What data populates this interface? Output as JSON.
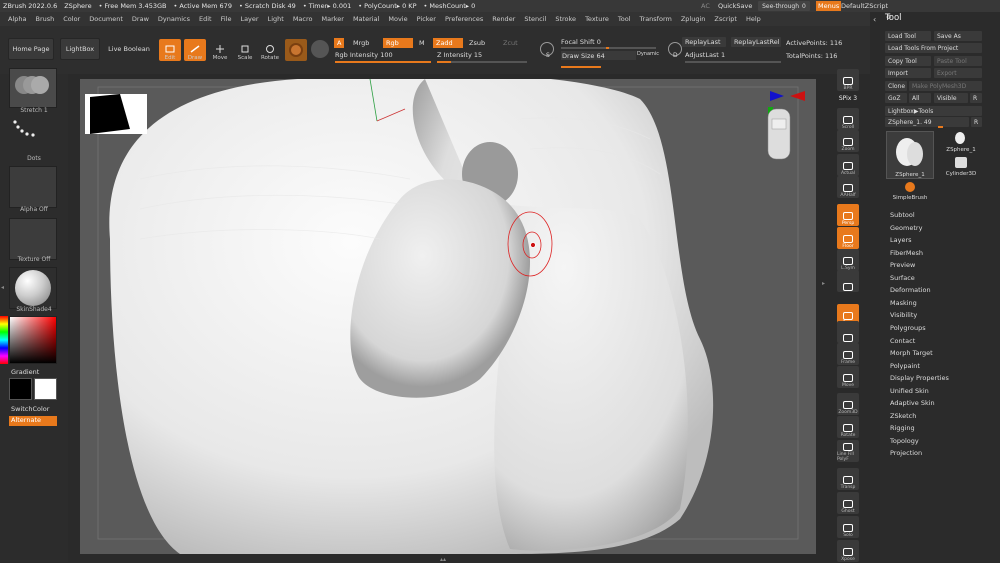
{
  "title_bar": {
    "app": "ZBrush 2022.0.6",
    "doc": "ZSphere",
    "free_mem": "• Free Mem 3.453GB",
    "active_mem": "• Active Mem 679",
    "scratch": "• Scratch Disk 49",
    "timer": "• Timer▸ 0.001",
    "polycount": "• PolyCount▸ 0 KP",
    "meshcount": "• MeshCount▸ 0",
    "ac": "AC",
    "quicksave": "QuickSave",
    "see_through": "See-through",
    "see_through_value": "0",
    "menus": "Menus",
    "default_zscript": "DefaultZScript"
  },
  "menu_bar": [
    "Alpha",
    "Brush",
    "Color",
    "Document",
    "Draw",
    "Dynamics",
    "Edit",
    "File",
    "Layer",
    "Light",
    "Macro",
    "Marker",
    "Material",
    "Movie",
    "Picker",
    "Preferences",
    "Render",
    "Stencil",
    "Stroke",
    "Texture",
    "Tool",
    "Transform",
    "Zplugin",
    "Zscript",
    "Help"
  ],
  "shelf": {
    "home_page": "Home Page",
    "lightbox": "LightBox",
    "live_boolean": "Live Boolean",
    "edit": "Edit",
    "draw": "Draw",
    "move": "Move",
    "scale": "Scale",
    "rotate": "Rotate",
    "a": "A",
    "mrgb": "Mrgb",
    "rgb": "Rgb",
    "m": "M",
    "zadd": "Zadd",
    "zsub": "Zsub",
    "zcut": "Zcut",
    "rgb_intensity": "Rgb Intensity",
    "rgb_intensity_value": "100",
    "z_intensity": "Z Intensity",
    "z_intensity_value": "15",
    "focal_shift": "Focal Shift",
    "focal_shift_value": "0",
    "draw_size": "Draw Size",
    "draw_size_value": "64",
    "dynamic": "Dynamic",
    "s": "S",
    "d": "D",
    "replay_last": "ReplayLast",
    "replay_last_rel": "ReplayLastRel",
    "adjust_last": "AdjustLast",
    "adjust_last_value": "1",
    "active_points": "ActivePoints: 116",
    "total_points": "TotalPoints: 116"
  },
  "left_panel": {
    "stroke": "Stretch 1",
    "alpha_dots": "Dots",
    "alpha": "Alpha Off",
    "texture": "Texture Off",
    "material": "SkinShade4",
    "gradient": "Gradient",
    "switch_color": "SwitchColor",
    "alternate": "Alternate"
  },
  "right_icons": [
    "BPR",
    "SPix 3",
    "Scroll",
    "Zoom",
    "Actual",
    "AAHalf",
    "Persp",
    "Floor",
    "L.Sym",
    "",
    "Qxyz",
    "",
    "Frame",
    "Move",
    "Zoom3D",
    "Rotate",
    "Line Fill PolyF",
    "Transp",
    "Ghost",
    "Solo",
    "Xpose"
  ],
  "tool_panel": {
    "title": "Tool",
    "load_tool": "Load Tool",
    "save_as": "Save As",
    "load_tools_from_project": "Load Tools From Project",
    "copy_tool": "Copy Tool",
    "paste_tool": "Paste Tool",
    "import": "Import",
    "export": "Export",
    "clone": "Clone",
    "make_polymesh": "Make PolyMesh3D",
    "goz": "GoZ",
    "all": "All",
    "visible": "Visible",
    "r": "R",
    "lightbox_tools": "Lightbox▶Tools",
    "zsphere_label": "ZSphere_1.",
    "zsphere_value": "49",
    "thumbs": [
      "ZSphere_1",
      "ZSphere_1",
      "Cylinder3D",
      "SimpleBrush"
    ],
    "sections": [
      "Subtool",
      "Geometry",
      "Layers",
      "FiberMesh",
      "Preview",
      "Surface",
      "Deformation",
      "Masking",
      "Visibility",
      "Polygroups",
      "Contact",
      "Morph Target",
      "Polypaint",
      "Display Properties",
      "Unified Skin",
      "Adaptive Skin",
      "ZSketch",
      "Rigging",
      "Topology",
      "Projection"
    ]
  },
  "colors": {
    "accent": "#e8791c",
    "panel": "#2b2b2b",
    "viewport": "#5a5a5a"
  }
}
